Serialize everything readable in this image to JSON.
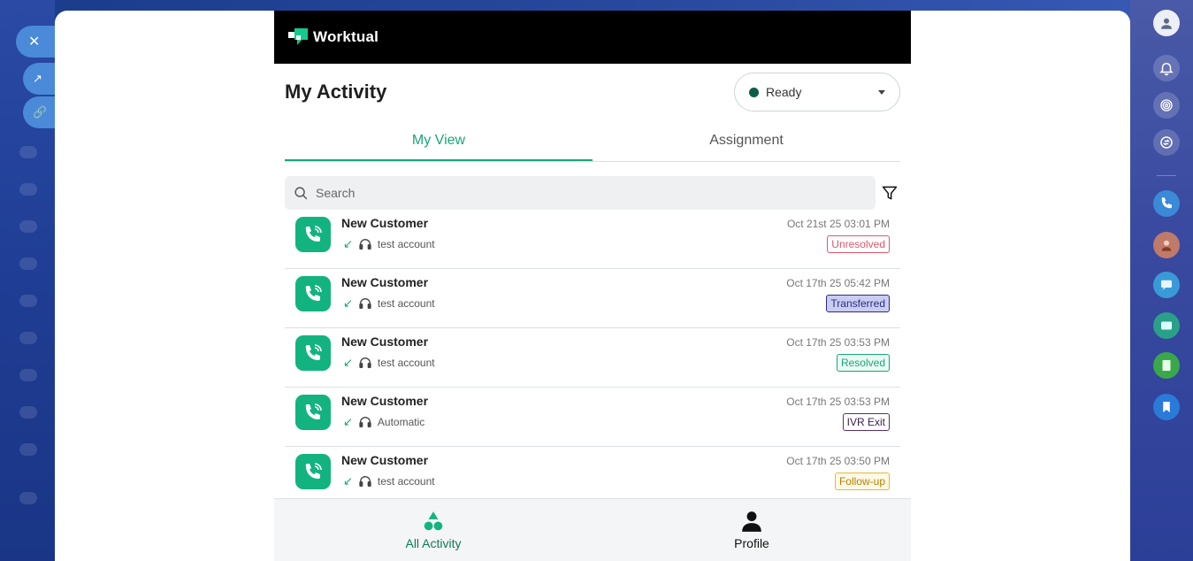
{
  "app": {
    "brand": "Worktual",
    "page_title": "My Activity",
    "status": {
      "label": "Ready",
      "color": "#0c5f47"
    }
  },
  "tabs": [
    {
      "label": "My View",
      "active": true
    },
    {
      "label": "Assignment",
      "active": false
    }
  ],
  "search": {
    "placeholder": "Search"
  },
  "activities": [
    {
      "name": "New Customer",
      "agent": "test account",
      "time": "Oct 21st 25 03:01 PM",
      "status": "Unresolved"
    },
    {
      "name": "New Customer",
      "agent": "test account",
      "time": "Oct 17th 25 05:42 PM",
      "status": "Transferred"
    },
    {
      "name": "New Customer",
      "agent": "test account",
      "time": "Oct 17th 25 03:53 PM",
      "status": "Resolved"
    },
    {
      "name": "New Customer",
      "agent": "Automatic",
      "time": "Oct 17th 25 03:53 PM",
      "status": "IVR Exit"
    },
    {
      "name": "New Customer",
      "agent": "test account",
      "time": "Oct 17th 25 03:50 PM",
      "status": "Follow-up"
    }
  ],
  "bottom_nav": {
    "all_activity": "All Activity",
    "profile": "Profile"
  },
  "colors": {
    "accent": "#1aa57a",
    "header": "#000000",
    "call_icon": "#13b37f"
  }
}
